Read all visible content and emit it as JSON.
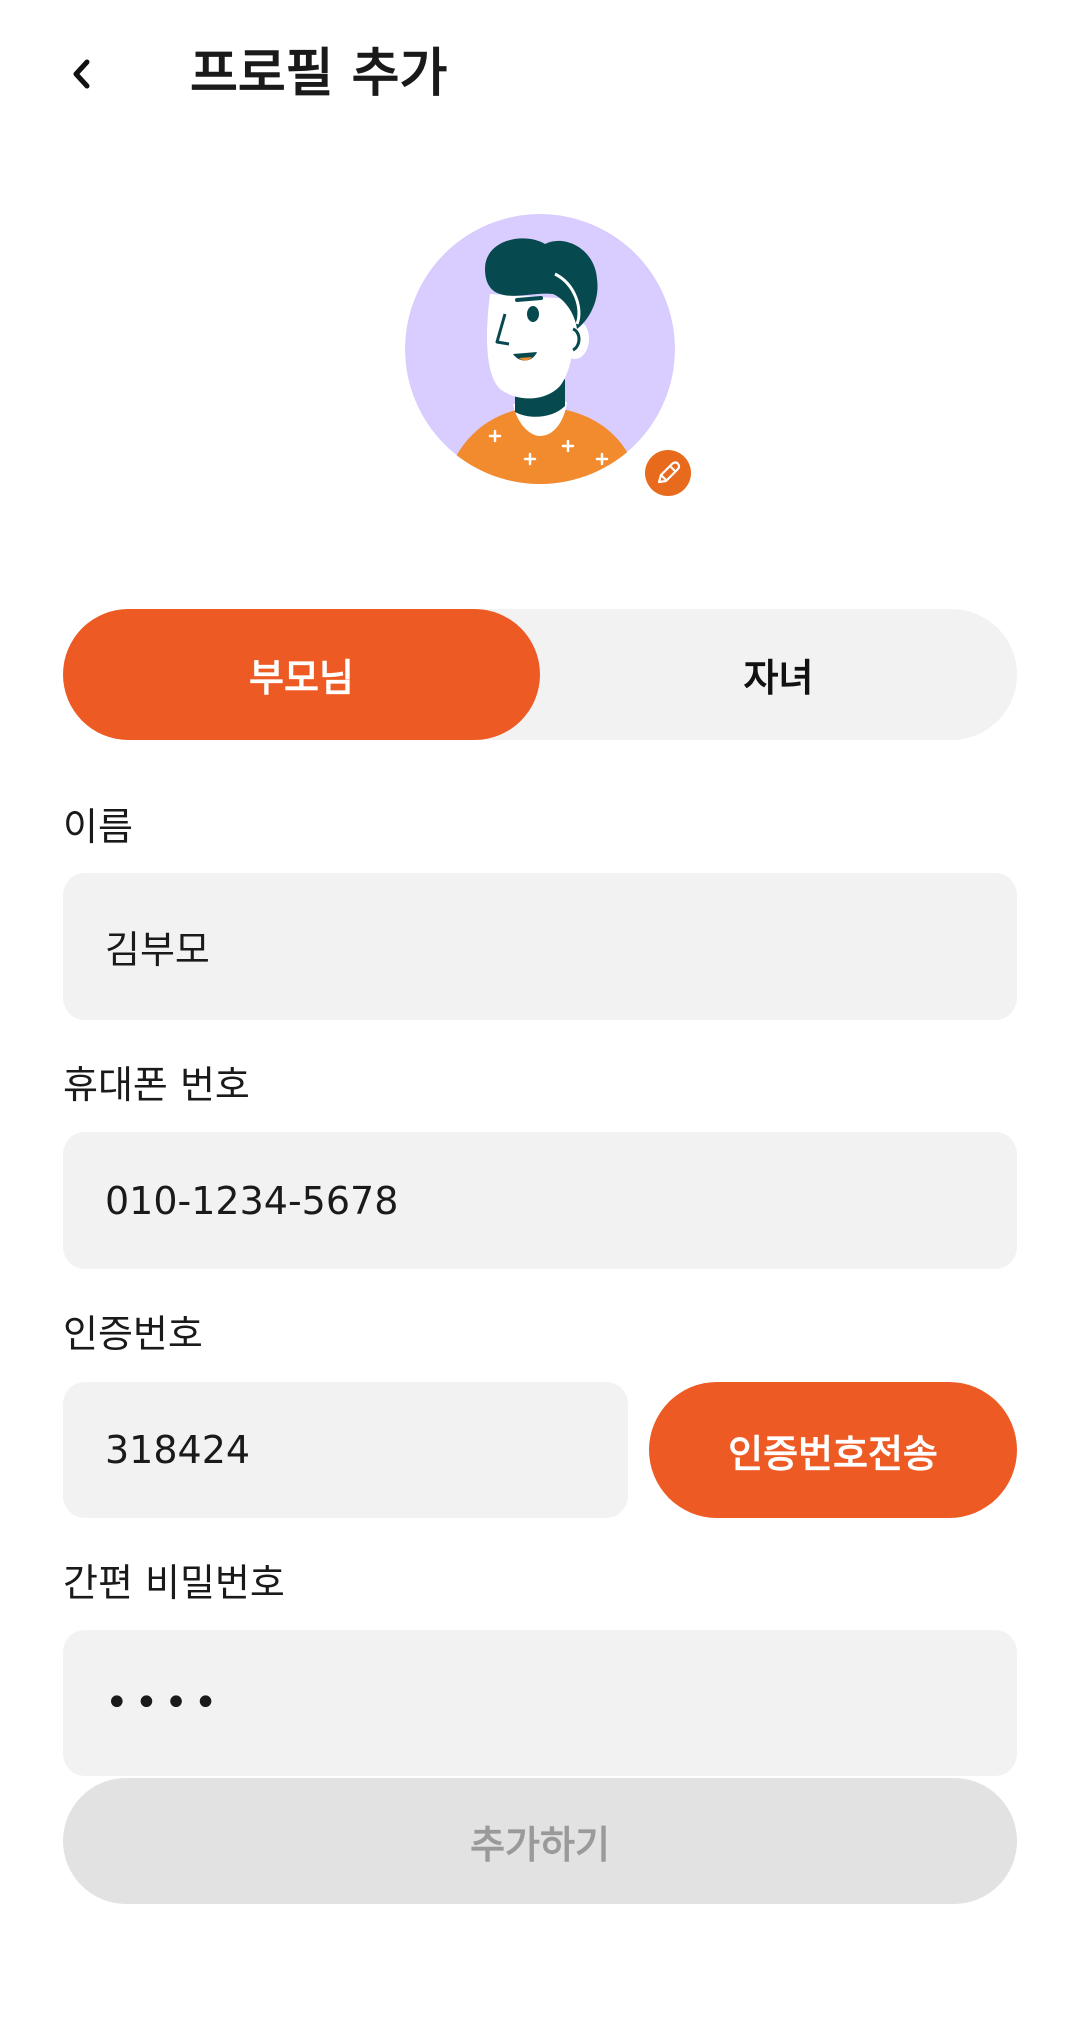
{
  "header": {
    "title": "프로필 추가",
    "back_icon": "chevron-left-icon"
  },
  "avatar": {
    "background_color": "#D9CCFF",
    "shirt_color": "#F28A2E",
    "hair_color": "#064A4F",
    "edit_icon": "pencil-icon",
    "edit_badge_color": "#E86A1C"
  },
  "role_toggle": {
    "options": [
      "부모님",
      "자녀"
    ],
    "selected": "부모님",
    "active_color": "#EE5A24"
  },
  "form": {
    "name": {
      "label": "이름",
      "value": "김부모"
    },
    "phone": {
      "label": "휴대폰 번호",
      "value": "010-1234-5678"
    },
    "verification": {
      "label": "인증번호",
      "value": "318424",
      "send_button_label": "인증번호전송"
    },
    "pin": {
      "label": "간편 비밀번호",
      "value": "••••"
    }
  },
  "submit": {
    "label": "추가하기",
    "disabled": true
  }
}
